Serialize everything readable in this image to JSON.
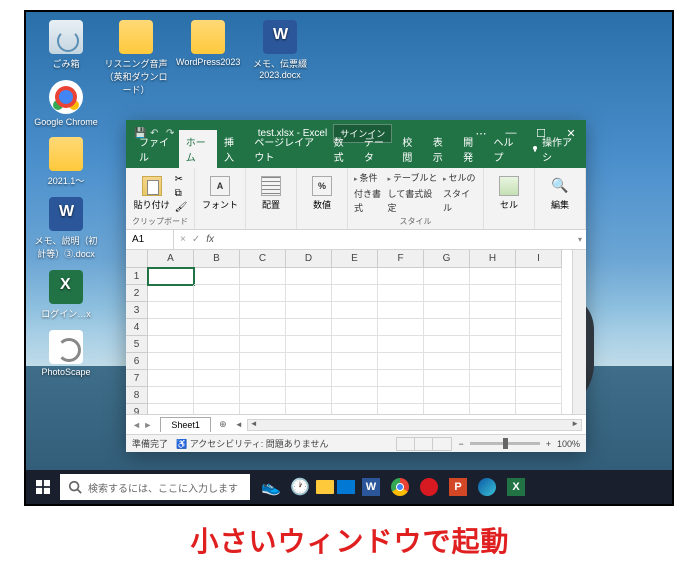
{
  "desktop": {
    "icons_col0": [
      "ごみ箱",
      "Google Chrome",
      "2021.1～",
      "メモ、説明（初計等）③.docx",
      "ログイン…x",
      "PhotoScape"
    ],
    "icons_col1": [
      "リスニング音声（英和ダウンロード）"
    ],
    "icons_col2": [
      "WordPress2023"
    ],
    "icons_col3": [
      "メモ、伝票綴 2023.docx"
    ]
  },
  "taskbar": {
    "search_placeholder": "検索するには、ここに入力します"
  },
  "excel": {
    "title": "test.xlsx - Excel",
    "signin": "サインイン",
    "tabs": [
      "ファイル",
      "ホーム",
      "挿入",
      "ページレイアウト",
      "数式",
      "データ",
      "校閲",
      "表示",
      "開発",
      "ヘルプ"
    ],
    "active_tab": 1,
    "tell_me": "操作アシ",
    "ribbon": {
      "clipboard": "クリップボード",
      "paste": "貼り付け",
      "font": "フォント",
      "alignment": "配置",
      "number": "数値",
      "styles": "スタイル",
      "cond_format": "条件付き書式",
      "table_format": "テーブルとして書式設定",
      "cell_styles": "セルのスタイル",
      "cells": "セル",
      "editing": "編集"
    },
    "name_box": "A1",
    "columns": [
      "A",
      "B",
      "C",
      "D",
      "E",
      "F",
      "G",
      "H",
      "I"
    ],
    "rows": [
      "1",
      "2",
      "3",
      "4",
      "5",
      "6",
      "7",
      "8",
      "9"
    ],
    "sheet": "Sheet1",
    "status_ready": "準備完了",
    "accessibility": "アクセシビリティ: 問題ありません",
    "zoom": "100%"
  },
  "caption": "小さいウィンドウで起動"
}
